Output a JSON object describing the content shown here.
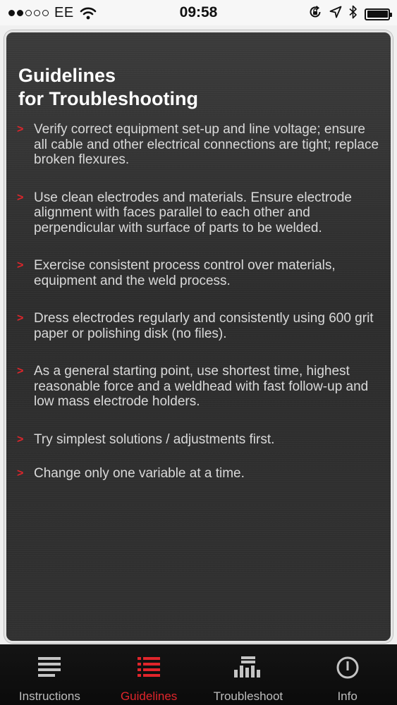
{
  "status_bar": {
    "carrier": "EE",
    "time": "09:58"
  },
  "panel": {
    "title": "Guidelines",
    "subtitle": "for Troubleshooting",
    "bullet": ">",
    "items": [
      {
        "text": "Verify correct equipment set-up and line voltage; ensure all cable and other electrical connections are tight; replace broken flexures."
      },
      {
        "text": "Use clean electrodes and materials. Ensure electrode alignment with faces parallel to each other and perpendicular with surface of parts to be welded."
      },
      {
        "text": "Exercise consistent process control over materials, equipment and the weld process."
      },
      {
        "text": "Dress electrodes regularly and consistently using 600 grit paper or polishing disk (no files)."
      },
      {
        "text": "As a general starting point, use shortest time, highest reasonable force and a weldhead with fast follow-up and low mass electrode holders."
      },
      {
        "text": "Try simplest solutions / adjustments first."
      },
      {
        "text": "Change only one variable at a time."
      }
    ]
  },
  "tabs": [
    {
      "label": "Instructions",
      "icon": "list-lines-icon",
      "active": false
    },
    {
      "label": "Guidelines",
      "icon": "bullet-list-icon",
      "active": true
    },
    {
      "label": "Troubleshoot",
      "icon": "bar-chart-icon",
      "active": false
    },
    {
      "label": "Info",
      "icon": "power-info-icon",
      "active": false
    }
  ],
  "colors": {
    "accent": "#e0252b",
    "panel_bg": "#2f2f2f",
    "tab_inactive": "#bdbdbd"
  }
}
